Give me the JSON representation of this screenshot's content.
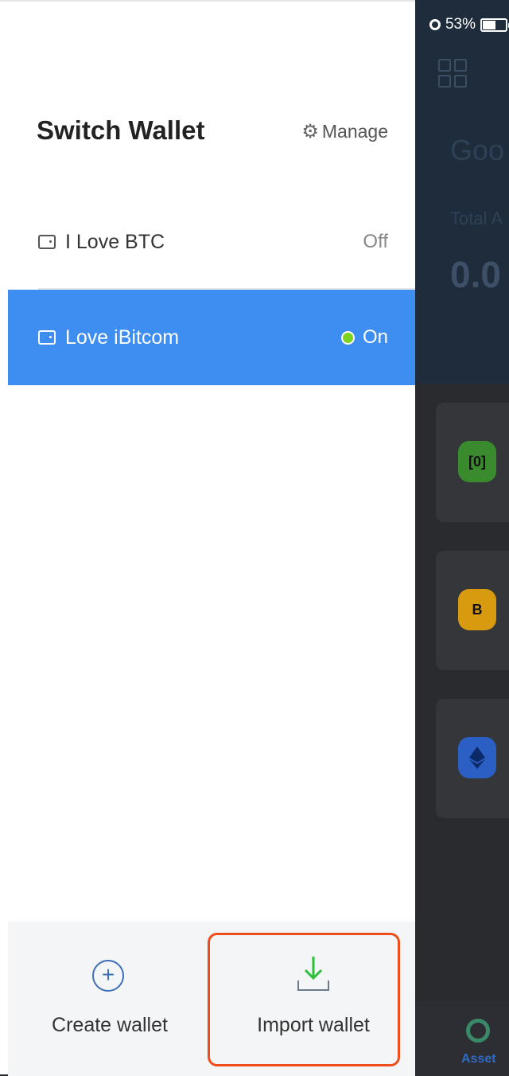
{
  "status_bar": {
    "battery_percent": "53%"
  },
  "background_app": {
    "greeting": "Goo",
    "total_label": "Total A",
    "amount": "0.0",
    "tab_label": "Asset"
  },
  "drawer": {
    "title": "Switch Wallet",
    "manage_label": "Manage",
    "wallets": [
      {
        "name": "I Love BTC",
        "state": "Off",
        "selected": false
      },
      {
        "name": "Love iBitcom",
        "state": "On",
        "selected": true
      }
    ],
    "create_label": "Create wallet",
    "import_label": "Import wallet"
  },
  "colors": {
    "accent": "#3d8ef0",
    "on_dot": "#7ed321",
    "highlight": "#f04d1c",
    "import_arrow": "#2cc03a"
  },
  "icons": [
    "gear-icon",
    "wallet-icon",
    "plus-circle-icon",
    "import-download-icon",
    "grid-icon",
    "alarm-icon",
    "battery-icon"
  ]
}
